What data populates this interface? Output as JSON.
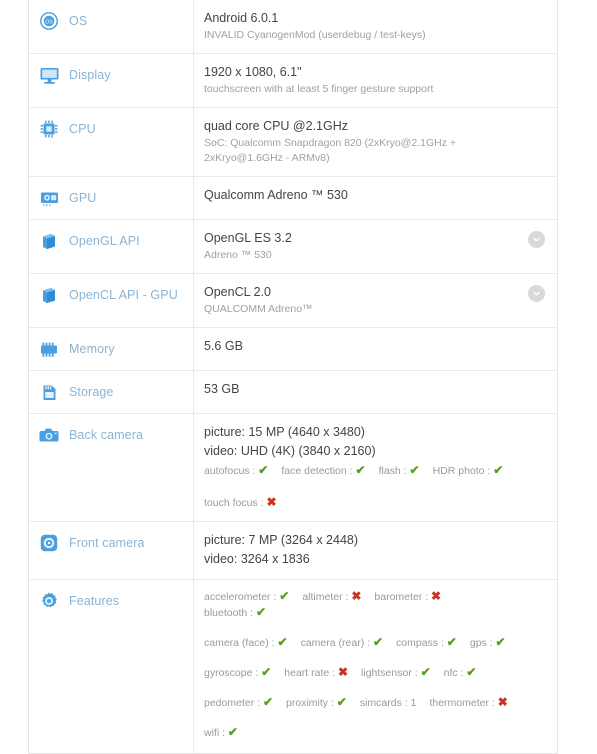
{
  "colors": {
    "icon_blue": "#4a9fe0",
    "label_blue": "#8ab4d4",
    "value_gray": "#444444",
    "sub_gray": "#a0a0a0",
    "check_green": "#5a9e20",
    "cross_red": "#cc3322",
    "border": "#eaeaea",
    "badge_gray": "#d9d9d9"
  },
  "rows": {
    "os": {
      "label": "OS",
      "icon": "os-disc-icon",
      "main": "Android 6.0.1",
      "sub": "INVALID CyanogenMod (userdebug / test-keys)"
    },
    "display": {
      "label": "Display",
      "icon": "monitor-icon",
      "main": "1920 x 1080, 6.1\"",
      "sub": "touchscreen with at least 5 finger gesture support"
    },
    "cpu": {
      "label": "CPU",
      "icon": "chip-icon",
      "main": "quad core CPU @2.1GHz",
      "sub": "SoC: Qualcomm Snapdragon 820 (2xKryo@2.1GHz + 2xKryo@1.6GHz - ARMv8)"
    },
    "gpu": {
      "label": "GPU",
      "icon": "gpu-card-icon",
      "main": "Qualcomm Adreno ™ 530",
      "sub": ""
    },
    "opengl": {
      "label": "OpenGL API",
      "icon": "cube-stack-icon",
      "main": "OpenGL ES 3.2",
      "sub": "Adreno ™ 530",
      "chevron": "chevron-down-icon"
    },
    "opencl": {
      "label": "OpenCL API - GPU",
      "icon": "cube-stack-icon",
      "main": "OpenCL 2.0",
      "sub": "QUALCOMM Adreno™",
      "chevron": "chevron-down-icon"
    },
    "memory": {
      "label": "Memory",
      "icon": "memory-chip-icon",
      "main": "5.6 GB",
      "sub": ""
    },
    "storage": {
      "label": "Storage",
      "icon": "storage-card-icon",
      "main": "53 GB",
      "sub": ""
    },
    "back_camera": {
      "label": "Back camera",
      "icon": "camera-icon",
      "picture": "picture: 15 MP (4640 x 3480)",
      "video": "video: UHD (4K) (3840 x 2160)",
      "caps_line1": [
        {
          "name": "autofocus",
          "value": "yes"
        },
        {
          "name": "face detection",
          "value": "yes"
        },
        {
          "name": "flash",
          "value": "yes"
        },
        {
          "name": "HDR photo",
          "value": "yes"
        }
      ],
      "caps_line2": [
        {
          "name": "touch focus",
          "value": "no"
        }
      ]
    },
    "front_camera": {
      "label": "Front camera",
      "icon": "front-camera-icon",
      "picture": "picture: 7 MP (3264 x 2448)",
      "video": "video: 3264 x 1836"
    },
    "features": {
      "label": "Features",
      "icon": "gear-icon",
      "lines": [
        [
          {
            "name": "accelerometer",
            "value": "yes"
          },
          {
            "name": "altimeter",
            "value": "no"
          },
          {
            "name": "barometer",
            "value": "no"
          },
          {
            "name": "bluetooth",
            "value": "yes"
          }
        ],
        [
          {
            "name": "camera (face)",
            "value": "yes"
          },
          {
            "name": "camera (rear)",
            "value": "yes"
          },
          {
            "name": "compass",
            "value": "yes"
          },
          {
            "name": "gps",
            "value": "yes"
          }
        ],
        [
          {
            "name": "gyroscope",
            "value": "yes"
          },
          {
            "name": "heart rate",
            "value": "no"
          },
          {
            "name": "lightsensor",
            "value": "yes"
          },
          {
            "name": "nfc",
            "value": "yes"
          }
        ],
        [
          {
            "name": "pedometer",
            "value": "yes"
          },
          {
            "name": "proximity",
            "value": "yes"
          },
          {
            "name": "simcards",
            "value": "1"
          },
          {
            "name": "thermometer",
            "value": "no"
          }
        ],
        [
          {
            "name": "wifi",
            "value": "yes"
          }
        ]
      ]
    }
  },
  "glyphs": {
    "check": "✔",
    "cross": "✖",
    "separator": ":"
  }
}
